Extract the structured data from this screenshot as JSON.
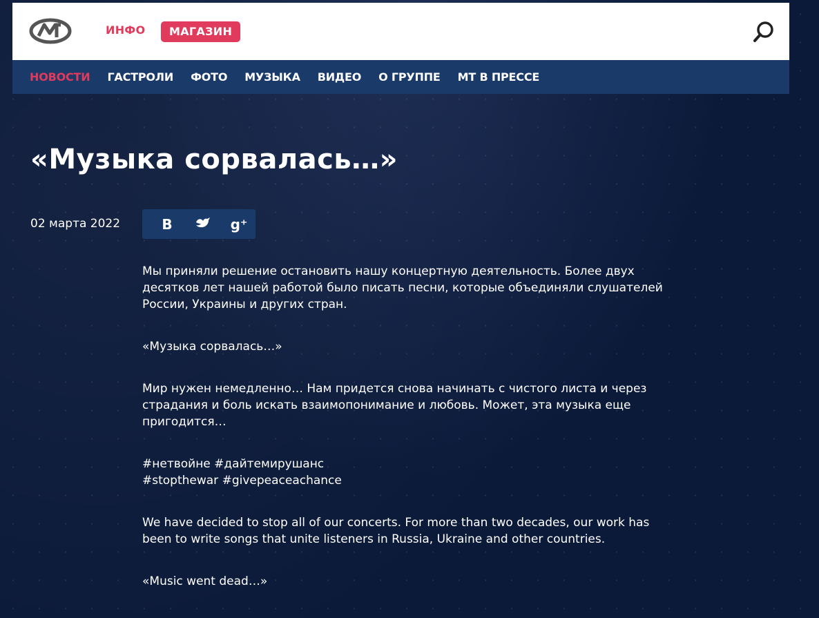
{
  "header": {
    "logo_icon": "mt-logo-icon",
    "info_label": "ИНФО",
    "shop_label": "МАГАЗИН",
    "search_icon": "search-icon"
  },
  "nav": {
    "items": [
      {
        "label": "НОВОСТИ",
        "active": true
      },
      {
        "label": "ГАСТРОЛИ",
        "active": false
      },
      {
        "label": "ФОТО",
        "active": false
      },
      {
        "label": "МУЗЫКА",
        "active": false
      },
      {
        "label": "ВИДЕО",
        "active": false
      },
      {
        "label": "О ГРУППЕ",
        "active": false
      },
      {
        "label": "МТ В ПРЕССЕ",
        "active": false
      }
    ]
  },
  "article": {
    "title": "«Музыка сорвалась…»",
    "date": "02 марта 2022",
    "share": {
      "vk": "В",
      "twitter_icon": "twitter-bird-icon",
      "gplus": "g⁺"
    },
    "paragraphs": [
      "Мы приняли решение остановить нашу концертную деятельность. Более двух десятков лет нашей работой было писать песни, которые объединяли слушателей России, Украины и других стран.",
      "«Музыка сорвалась…»",
      "Мир нужен немедленно… Нам придется снова начинать с чистого листа и через страдания и боль искать взаимопонимание и любовь. Может, эта музыка еще пригодится…",
      "#нетвойне #дайтемирушанс\n#stopthewar #givepeaceachance",
      "We have decided to stop all of our concerts. For more than two decades, our work has been to write songs that unite listeners in Russia, Ukraine and other countries.",
      "«Music went dead…»"
    ]
  },
  "colors": {
    "background": "#0c1a3a",
    "nav_bg": "#1a3a6a",
    "accent": "#e03a5c"
  }
}
